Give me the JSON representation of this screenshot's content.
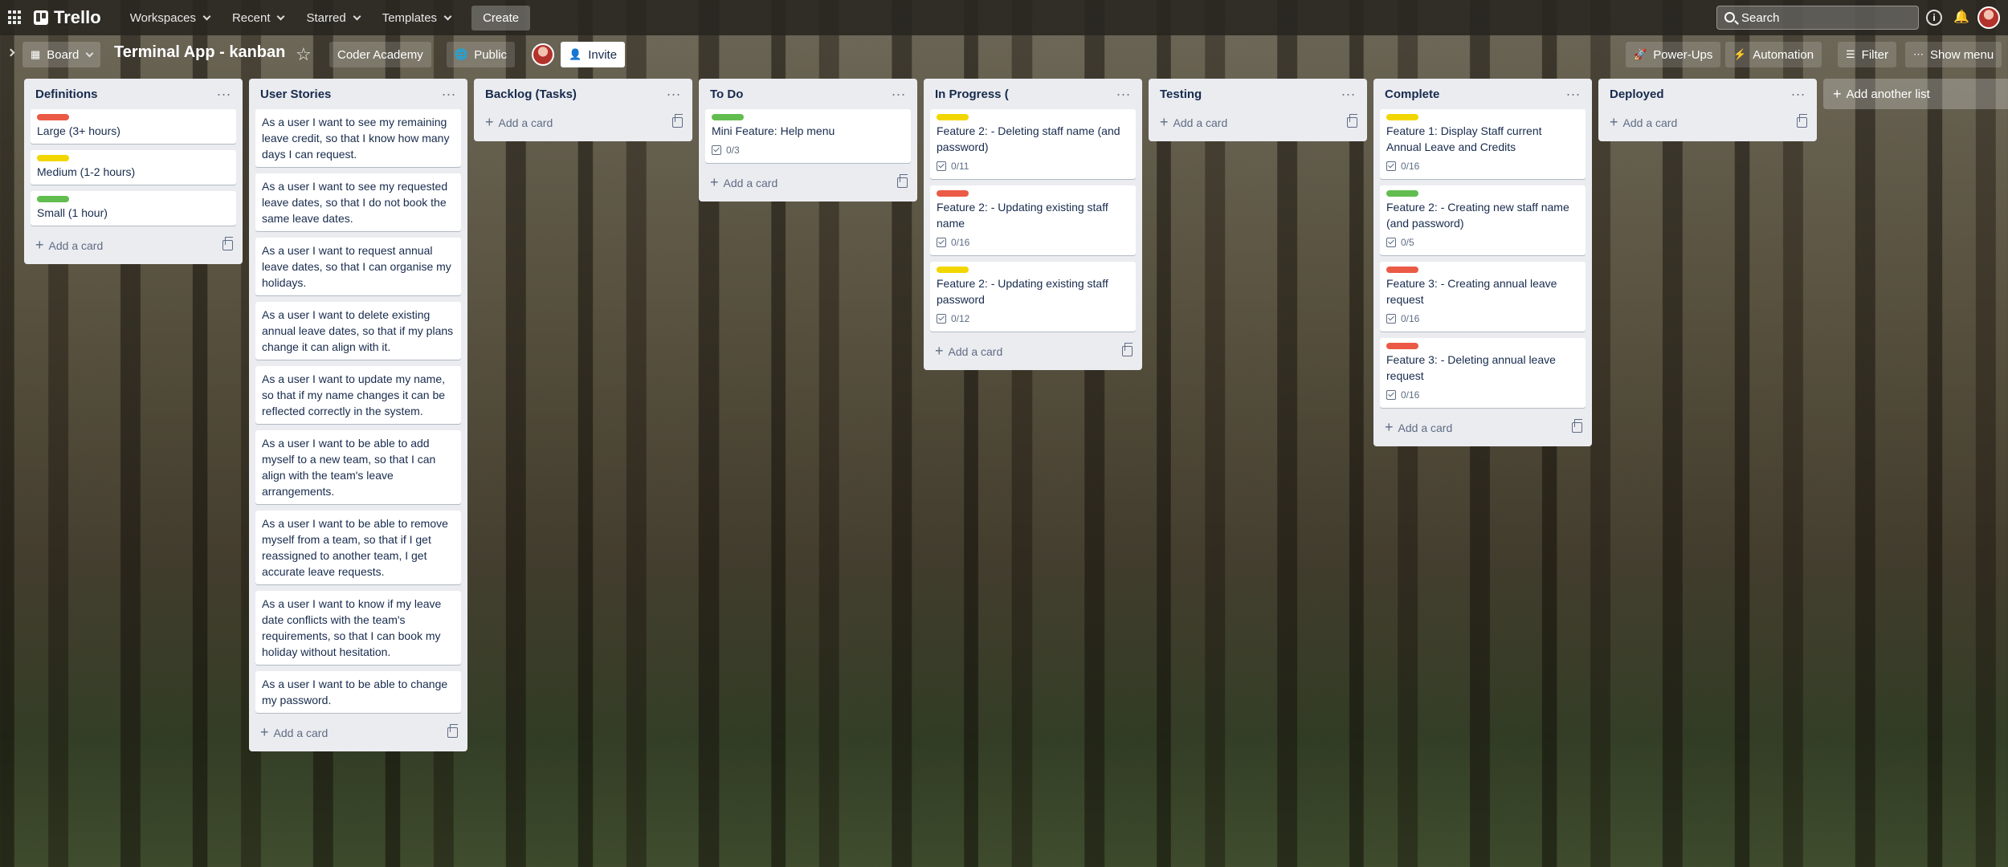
{
  "topbar": {
    "app_name": "Trello",
    "nav": [
      "Workspaces",
      "Recent",
      "Starred",
      "Templates"
    ],
    "create_label": "Create",
    "search_placeholder": "Search"
  },
  "board_header": {
    "view_label": "Board",
    "title": "Terminal App - kanban",
    "workspace_label": "Coder Academy",
    "visibility_label": "Public",
    "invite_label": "Invite",
    "powerups_label": "Power-Ups",
    "automation_label": "Automation",
    "filter_label": "Filter",
    "menu_label": "Show menu"
  },
  "colors": {
    "red": "#eb5a46",
    "yellow": "#f2d600",
    "green": "#61bd4f"
  },
  "lists": [
    {
      "title": "Definitions",
      "cards": [
        {
          "label": "red",
          "text": "Large (3+ hours)"
        },
        {
          "label": "yellow",
          "text": "Medium (1-2 hours)"
        },
        {
          "label": "green",
          "text": "Small (1 hour)"
        }
      ]
    },
    {
      "title": "User Stories",
      "cards": [
        {
          "text": "As a user I want to see my remaining leave credit, so that I know how many days I can request."
        },
        {
          "text": "As a user I want to see my requested leave dates, so that I do not book the same leave dates."
        },
        {
          "text": "As a user I want to request annual leave dates, so that I can organise my holidays."
        },
        {
          "text": "As a user I want to delete existing annual leave dates, so that if my plans change it can align with it."
        },
        {
          "text": "As a user I want to update my name, so that if my name changes it can be reflected correctly in the system."
        },
        {
          "text": "As a user I want to be able to add myself to a new team, so that I can align with the team's leave arrangements."
        },
        {
          "text": "As a user I want to be able to remove myself from a team, so that if I get reassigned to another team, I get accurate leave requests."
        },
        {
          "text": "As a user I want to know if my leave date conflicts with the team's requirements, so that I can book my holiday without hesitation."
        },
        {
          "text": "As a user I want to be able to change my password."
        }
      ]
    },
    {
      "title": "Backlog (Tasks)",
      "cards": []
    },
    {
      "title": "To Do",
      "cards": [
        {
          "label": "green",
          "text": "Mini Feature: Help menu",
          "checklist": "0/3"
        }
      ]
    },
    {
      "title": "In Progress (",
      "cards": [
        {
          "label": "yellow",
          "text": "Feature 2: - Deleting staff name (and password)",
          "checklist": "0/11"
        },
        {
          "label": "red",
          "text": "Feature 2: - Updating existing staff name",
          "checklist": "0/16"
        },
        {
          "label": "yellow",
          "text": "Feature 2: - Updating existing staff password",
          "checklist": "0/12"
        }
      ]
    },
    {
      "title": "Testing",
      "cards": []
    },
    {
      "title": "Complete",
      "cards": [
        {
          "label": "yellow",
          "text": "Feature 1: Display Staff current Annual Leave and Credits",
          "checklist": "0/16"
        },
        {
          "label": "green",
          "text": "Feature 2: - Creating new staff name (and password)",
          "checklist": "0/5"
        },
        {
          "label": "red",
          "text": "Feature 3: - Creating annual leave request",
          "checklist": "0/16"
        },
        {
          "label": "red",
          "text": "Feature 3: - Deleting annual leave request",
          "checklist": "0/16"
        }
      ]
    },
    {
      "title": "Deployed",
      "cards": []
    }
  ],
  "add_card_label": "Add a card",
  "add_list_label": "Add another list"
}
